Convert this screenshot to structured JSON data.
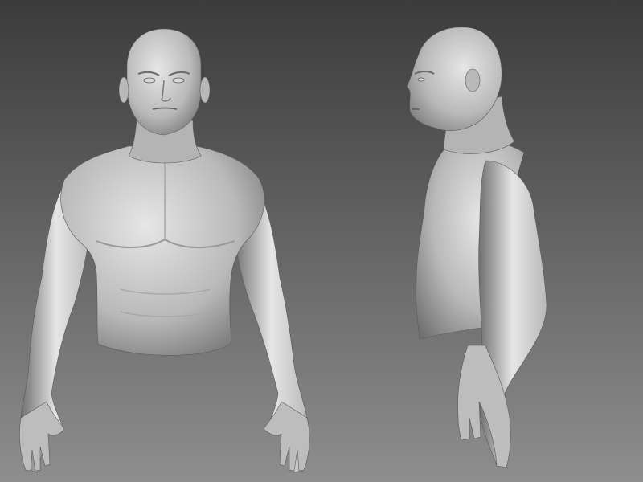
{
  "scene": {
    "background_top": "#3b3b3b",
    "background_bottom": "#8e8e8e",
    "model_light": "#e6e6e6",
    "model_mid": "#b9b9b9",
    "model_dark": "#6f6f6f",
    "views": [
      {
        "name": "front-view"
      },
      {
        "name": "side-view"
      }
    ]
  }
}
